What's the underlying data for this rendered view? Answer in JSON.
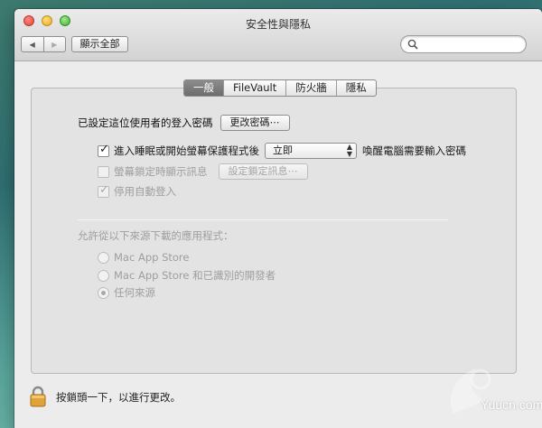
{
  "window": {
    "title": "安全性與隱私"
  },
  "toolbar": {
    "back": "◀",
    "forward": "▶",
    "show_all": "顯示全部",
    "search_placeholder": ""
  },
  "tabs": [
    {
      "label": "一般",
      "active": true
    },
    {
      "label": "FileVault",
      "active": false
    },
    {
      "label": "防火牆",
      "active": false
    },
    {
      "label": "隱私",
      "active": false
    }
  ],
  "general": {
    "password_label": "已設定這位使用者的登入密碼",
    "change_password_button": "更改密碼⋯",
    "require_password": {
      "label": "進入睡眠或開始螢幕保護程式後",
      "checked": true,
      "after_label": "喚醒電腦需要輸入密碼"
    },
    "require_select": {
      "value": "立即"
    },
    "lock_message": {
      "label": "螢幕鎖定時顯示訊息",
      "checked": false,
      "enabled": false,
      "button": "設定鎖定訊息⋯"
    },
    "disable_autologin": {
      "label": "停用自動登入",
      "checked": true,
      "enabled": false
    }
  },
  "downloads": {
    "heading": "允許從以下來源下載的應用程式：",
    "options": [
      {
        "label": "Mac App Store",
        "selected": false
      },
      {
        "label": "Mac App Store 和已識別的開發者",
        "selected": false
      },
      {
        "label": "任何來源",
        "selected": true
      }
    ]
  },
  "footer": {
    "lock_text": "按鎖頭一下，以進行更改。"
  },
  "watermark": {
    "text": "Yuucn.com"
  },
  "colors": {
    "active_tab": "#7a7a7a",
    "panel": "#e3e3e3",
    "window": "#ececec"
  }
}
